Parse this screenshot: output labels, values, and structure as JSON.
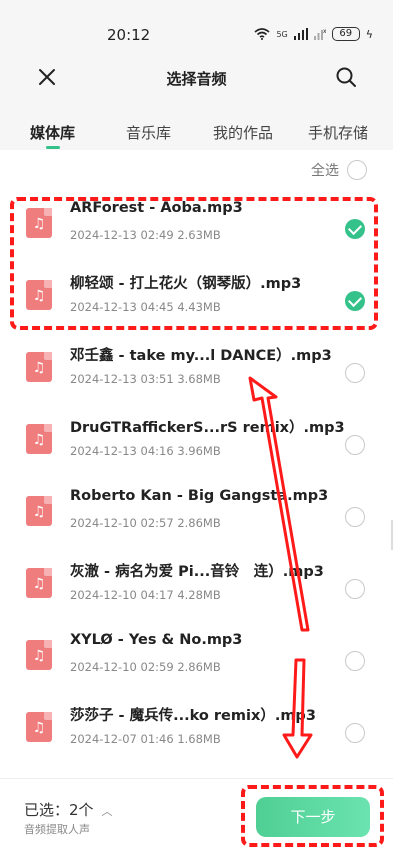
{
  "status_bar": {
    "time": "20:12",
    "wifi_icon": "wifi-icon",
    "signal_label": "5G",
    "battery": "69"
  },
  "header": {
    "title": "选择音频",
    "close_icon": "close-icon",
    "search_icon": "search-icon"
  },
  "tabs": [
    {
      "label": "媒体库",
      "active": true
    },
    {
      "label": "音乐库",
      "active": false
    },
    {
      "label": "我的作品",
      "active": false
    },
    {
      "label": "手机存储",
      "active": false
    }
  ],
  "select_all": {
    "label": "全选",
    "checked": false
  },
  "files": [
    {
      "name": "ARForest - Aoba.mp3",
      "date": "2024-12-13",
      "time": "02:49",
      "size": "2.63MB",
      "checked": true
    },
    {
      "name": "柳轻颂 - 打上花火（钢琴版）.mp3",
      "date": "2024-12-13",
      "time": "04:45",
      "size": "4.43MB",
      "checked": true
    },
    {
      "name": "邓壬鑫 - take my...l DANCE）.mp3",
      "date": "2024-12-13",
      "time": "03:51",
      "size": "3.68MB",
      "checked": false
    },
    {
      "name": "DruGTRaffickerS...rS remix）.mp3",
      "date": "2024-12-13",
      "time": "04:16",
      "size": "3.96MB",
      "checked": false
    },
    {
      "name": "Roberto Kan - Big Gangsta.mp3",
      "date": "2024-12-10",
      "time": "02:57",
      "size": "2.86MB",
      "checked": false
    },
    {
      "name": "灰澈 - 病名为爱 Pi...音铃　连）.mp3",
      "date": "2024-12-10",
      "time": "04:17",
      "size": "4.28MB",
      "checked": false
    },
    {
      "name": "XYLØ - Yes & No.mp3",
      "date": "2024-12-10",
      "time": "02:59",
      "size": "2.86MB",
      "checked": false
    },
    {
      "name": "莎莎子 - 魔兵传...ko remix）.mp3",
      "date": "2024-12-07",
      "time": "01:46",
      "size": "1.68MB",
      "checked": false
    }
  ],
  "bottom": {
    "selected_label": "已选：2个",
    "sub_label": "音频提取人声",
    "next_label": "下一步"
  },
  "colors": {
    "accent": "#35c28a",
    "file_icon": "#f07d7d",
    "annotation": "#ff1a1a"
  }
}
